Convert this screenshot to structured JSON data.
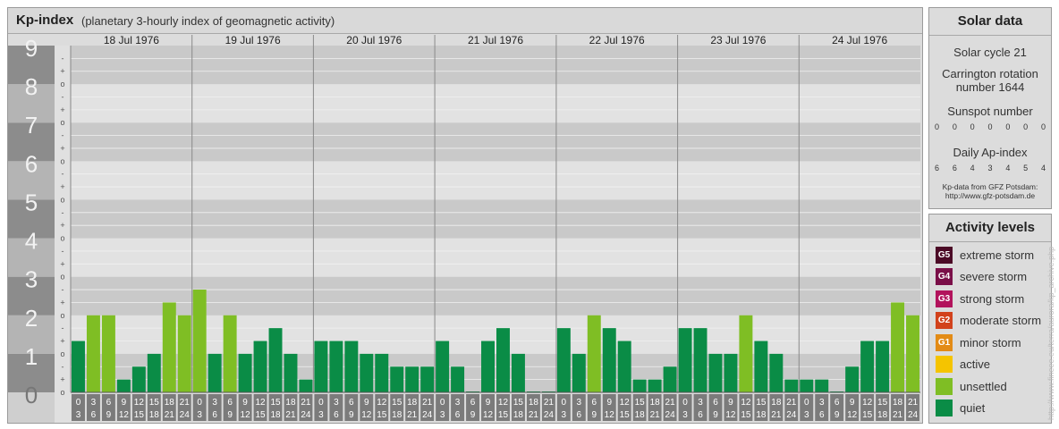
{
  "header": {
    "title": "Kp-index",
    "subtitle": "(planetary 3-hourly index of geomagnetic activity)"
  },
  "chart_data": {
    "type": "bar",
    "y_major_ticks": [
      "0",
      "1",
      "2",
      "3",
      "4",
      "5",
      "6",
      "7",
      "8",
      "9"
    ],
    "y_minor_tick_cycle": [
      "o",
      "+",
      "-"
    ],
    "ylim": [
      0,
      9
    ],
    "days": [
      "18 Jul 1976",
      "19 Jul 1976",
      "20 Jul 1976",
      "21 Jul 1976",
      "22 Jul 1976",
      "23 Jul 1976",
      "24 Jul 1976"
    ],
    "interval_start_labels": [
      "0",
      "3",
      "6",
      "9",
      "12",
      "15",
      "18",
      "21"
    ],
    "interval_end_labels": [
      "3",
      "6",
      "9",
      "12",
      "15",
      "18",
      "21",
      "24"
    ],
    "values": [
      [
        1.333,
        2.0,
        2.0,
        0.333,
        0.667,
        1.0,
        2.333,
        2.0
      ],
      [
        2.667,
        1.0,
        2.0,
        1.0,
        1.333,
        1.667,
        1.0,
        0.333
      ],
      [
        1.333,
        1.333,
        1.333,
        1.0,
        1.0,
        0.667,
        0.667,
        0.667
      ],
      [
        1.333,
        0.667,
        0.0,
        1.333,
        1.667,
        1.0,
        0.0,
        0.0
      ],
      [
        1.667,
        1.0,
        2.0,
        1.667,
        1.333,
        0.333,
        0.333,
        0.667
      ],
      [
        1.667,
        1.667,
        1.0,
        1.0,
        2.0,
        1.333,
        1.0,
        0.333
      ],
      [
        0.333,
        0.333,
        0.0,
        0.667,
        1.333,
        1.333,
        2.333,
        2.0
      ]
    ],
    "level_colors": {
      "quiet": "#0a8c46",
      "unsettled": "#7fbe24",
      "active": "#f5c400",
      "minor": "#e38b16",
      "moderate": "#d2421c",
      "strong": "#b2135c",
      "severe": "#7a0f48",
      "extreme": "#4b0a26"
    }
  },
  "solar_data": {
    "title": "Solar data",
    "solar_cycle": "Solar cycle 21",
    "carrington_line1": "Carrington rotation",
    "carrington_line2": "number 1644",
    "sunspot_label": "Sunspot number",
    "sunspot_values": [
      "0",
      "0",
      "0",
      "0",
      "0",
      "0",
      "0"
    ],
    "ap_label": "Daily Ap-index",
    "ap_values": [
      "6",
      "6",
      "4",
      "3",
      "4",
      "5",
      "4"
    ],
    "source_line1": "Kp-data from GFZ Potsdam:",
    "source_line2": "http://www.gfz-potsdam.de"
  },
  "activity_levels": {
    "title": "Activity levels",
    "items": [
      {
        "code": "G5",
        "label": "extreme storm",
        "color": "#4b0a26"
      },
      {
        "code": "G4",
        "label": "severe storm",
        "color": "#7a0f48"
      },
      {
        "code": "G3",
        "label": "strong storm",
        "color": "#b2135c"
      },
      {
        "code": "G2",
        "label": "moderate storm",
        "color": "#d2421c"
      },
      {
        "code": "G1",
        "label": "minor storm",
        "color": "#e38b16"
      },
      {
        "code": "",
        "label": "active",
        "color": "#f5c400"
      },
      {
        "code": "",
        "label": "unsettled",
        "color": "#7fbe24"
      },
      {
        "code": "",
        "label": "quiet",
        "color": "#0a8c46"
      }
    ]
  },
  "watermark": "http://www.fineee.eu/terra/aurora/kp_archive.php"
}
